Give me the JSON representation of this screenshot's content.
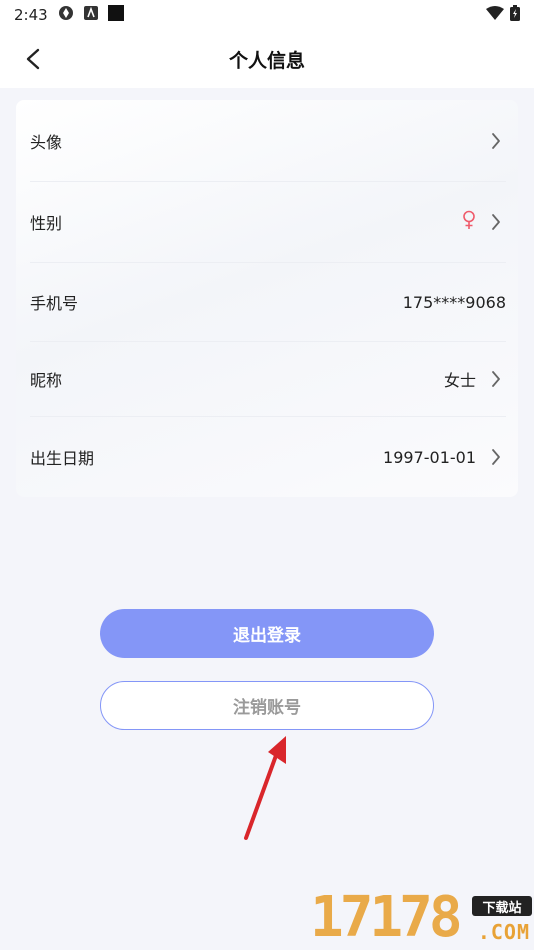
{
  "status_bar": {
    "time": "2:43"
  },
  "nav": {
    "title": "个人信息"
  },
  "profile_rows": {
    "avatar": {
      "label": "头像"
    },
    "gender": {
      "label": "性别",
      "value_icon": "female-icon"
    },
    "phone": {
      "label": "手机号",
      "value": "175****9068"
    },
    "nickname": {
      "label": "昵称",
      "value": "女士"
    },
    "birthday": {
      "label": "出生日期",
      "value": "1997-01-01"
    }
  },
  "buttons": {
    "logout": "退出登录",
    "cancel_account": "注销账号"
  },
  "watermark": {
    "digits": "17178",
    "tag": "下载站",
    "domain": ".COM"
  },
  "colors": {
    "accent": "#8496f7",
    "female_icon": "#ef5b6b",
    "annotation_arrow": "#d9262b",
    "watermark": "#e8a236"
  }
}
